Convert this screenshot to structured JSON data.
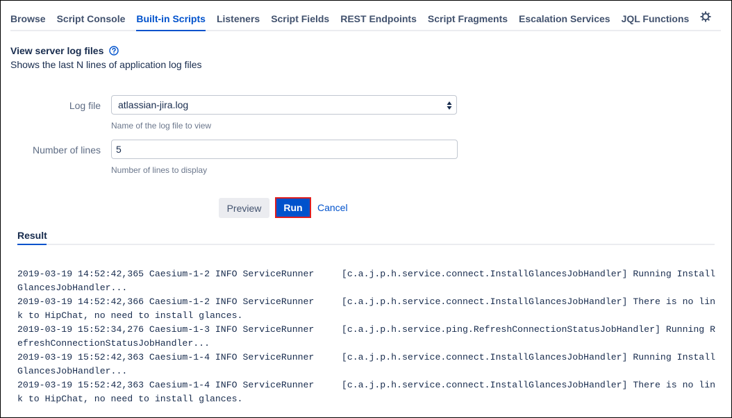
{
  "nav": {
    "tabs": [
      {
        "label": "Browse",
        "active": false
      },
      {
        "label": "Script Console",
        "active": false
      },
      {
        "label": "Built-in Scripts",
        "active": true
      },
      {
        "label": "Listeners",
        "active": false
      },
      {
        "label": "Script Fields",
        "active": false
      },
      {
        "label": "REST Endpoints",
        "active": false
      },
      {
        "label": "Script Fragments",
        "active": false
      },
      {
        "label": "Escalation Services",
        "active": false
      },
      {
        "label": "JQL Functions",
        "active": false
      }
    ],
    "settings_icon": "gear-icon"
  },
  "script": {
    "title": "View server log files",
    "help_icon": "question-circle-icon",
    "description": "Shows the last N lines of application log files"
  },
  "form": {
    "log_file": {
      "label": "Log file",
      "value": "atlassian-jira.log",
      "help": "Name of the log file to view"
    },
    "num_lines": {
      "label": "Number of lines",
      "value": "5",
      "help": "Number of lines to display"
    },
    "buttons": {
      "preview": "Preview",
      "run": "Run",
      "cancel": "Cancel"
    }
  },
  "result": {
    "tab_label": "Result",
    "lines": [
      "2019-03-19 14:52:42,365 Caesium-1-2 INFO ServiceRunner     [c.a.j.p.h.service.connect.InstallGlancesJobHandler] Running InstallGlancesJobHandler...",
      "2019-03-19 14:52:42,366 Caesium-1-2 INFO ServiceRunner     [c.a.j.p.h.service.connect.InstallGlancesJobHandler] There is no link to HipChat, no need to install glances.",
      "2019-03-19 15:52:34,276 Caesium-1-3 INFO ServiceRunner     [c.a.j.p.h.service.ping.RefreshConnectionStatusJobHandler] Running RefreshConnectionStatusJobHandler...",
      "2019-03-19 15:52:42,363 Caesium-1-4 INFO ServiceRunner     [c.a.j.p.h.service.connect.InstallGlancesJobHandler] Running InstallGlancesJobHandler...",
      "2019-03-19 15:52:42,363 Caesium-1-4 INFO ServiceRunner     [c.a.j.p.h.service.connect.InstallGlancesJobHandler] There is no link to HipChat, no need to install glances."
    ]
  },
  "colors": {
    "accent": "#0052cc",
    "run_highlight": "#e01e1e",
    "text_primary": "#172b4d",
    "text_secondary": "#5e6c84"
  }
}
